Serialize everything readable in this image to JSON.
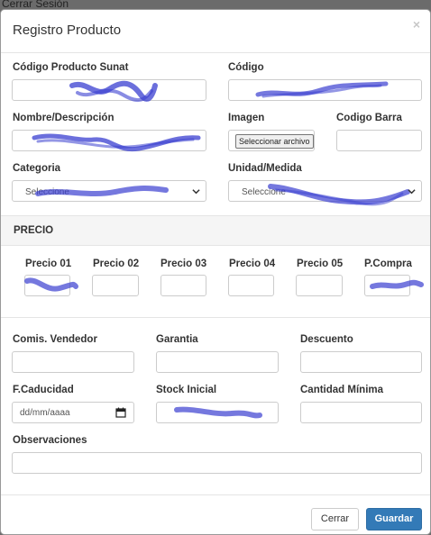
{
  "backdrop": {
    "logout_link": "Cerrar Sesión"
  },
  "modal": {
    "title": "Registro Producto",
    "close_label": "×"
  },
  "fields": {
    "codigo_sunat_label": "Código Producto Sunat",
    "codigo_label": "Código",
    "nombre_label": "Nombre/Descripción",
    "imagen_label": "Imagen",
    "imagen_button": "Seleccionar archivo",
    "codigo_barra_label": "Codigo Barra",
    "categoria_label": "Categoria",
    "categoria_selected": "Seleccione",
    "unidad_label": "Unidad/Medida",
    "unidad_selected": "Seleccione"
  },
  "precio_section": {
    "title": "PRECIO",
    "labels": [
      "Precio 01",
      "Precio 02",
      "Precio 03",
      "Precio 04",
      "Precio 05",
      "P.Compra"
    ]
  },
  "extra": {
    "comision_label": "Comis. Vendedor",
    "garantia_label": "Garantia",
    "descuento_label": "Descuento",
    "caducidad_label": "F.Caducidad",
    "caducidad_placeholder": "dd/mm/aaaa",
    "stock_label": "Stock Inicial",
    "cantidad_min_label": "Cantidad Mínima",
    "observaciones_label": "Observaciones"
  },
  "footer": {
    "cancel_label": "Cerrar",
    "save_label": "Guardar"
  },
  "colors": {
    "primary": "#337ab7",
    "redaction": "#3a3fd0"
  }
}
